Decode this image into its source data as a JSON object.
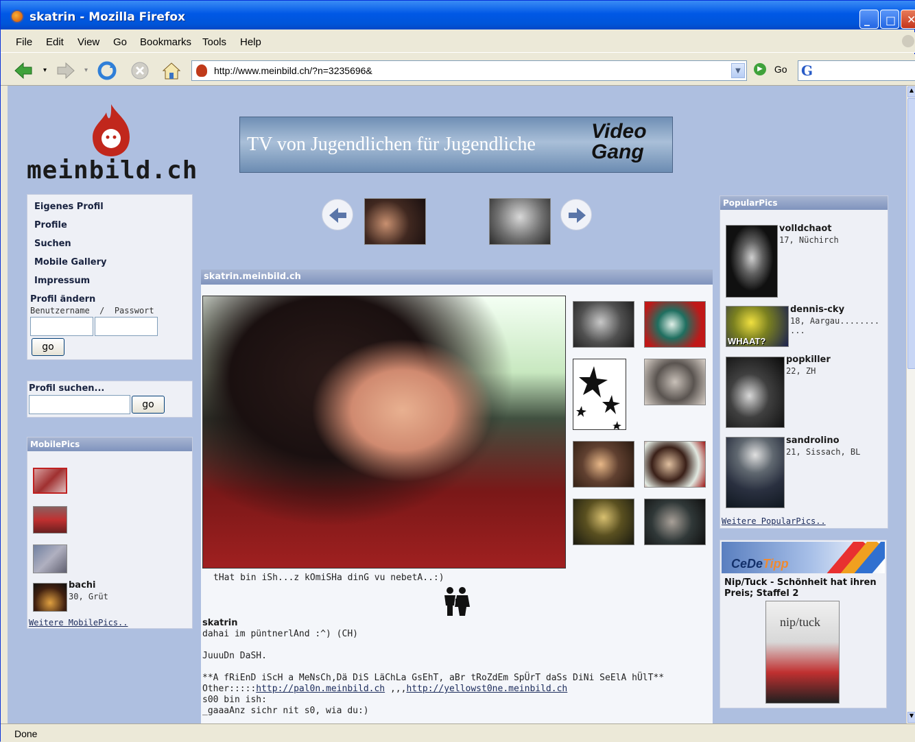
{
  "window": {
    "title": "skatrin - Mozilla Firefox"
  },
  "menu": [
    "File",
    "Edit",
    "View",
    "Go",
    "Bookmarks",
    "Tools",
    "Help"
  ],
  "address": {
    "url": "http://www.meinbild.ch/?n=3235696&",
    "go_label": "Go"
  },
  "status": "Done",
  "site": {
    "logo_text": "meinbild.ch",
    "banner_text": "TV von Jugendlichen für Jugendliche",
    "banner_brand": "Video Gang"
  },
  "nav": {
    "items": [
      "Eigenes Profil",
      "Profile",
      "Suchen",
      "Mobile Gallery",
      "Impressum"
    ],
    "profil_aendern": "Profil ändern",
    "login_label": "Benutzername  /  Passwort",
    "go": "go"
  },
  "search": {
    "label": "Profil suchen...",
    "go": "go"
  },
  "mobilepics": {
    "header": "MobilePics",
    "user": {
      "name": "bachi",
      "info": "30, Grüt"
    },
    "more": "Weitere MobilePics.."
  },
  "profile": {
    "header": "skatrin.meinbild.ch",
    "caption": "tHat bin iSh...z kOmiSHa dinG vu nebetA..:)",
    "username": "skatrin",
    "lines": [
      "dahai im püntnerlAnd :^) (CH)",
      "",
      "JuuuDn DaSH.",
      "",
      "**A fRiEnD iScH a MeNsCh,Dä DiS LäChLa GsEhT, aBr tRoZdEm SpÜrT daSs DiNi SeElA hÜlT**"
    ],
    "other_prefix": "Other:::::",
    "other_link1": "http://pal0n.meinbild.ch",
    "other_sep": " ,,,",
    "other_link2": "http://yellowst0ne.meinbild.ch",
    "more_lines": [
      "s00 bin ish:",
      "_gaaaAnz sichr nit s0, wia du:)"
    ]
  },
  "popularpics": {
    "header": "PopularPics",
    "users": [
      {
        "name": "volldchaot",
        "info": "17, Nüchirch"
      },
      {
        "name": "dennis-cky",
        "info": "18, Aargau........ ..."
      },
      {
        "name": "popkiller",
        "info": "22, ZH"
      },
      {
        "name": "sandrolino",
        "info": "21, Sissach, BL"
      }
    ],
    "whaat": "WHAAT?",
    "more": "Weitere PopularPics.."
  },
  "ad": {
    "brand": "CeDe",
    "brand2": "Tipp",
    "title": "Nip/Tuck - Schönheit hat ihren Preis; Staffel 2",
    "cover_text": "nip/tuck"
  }
}
